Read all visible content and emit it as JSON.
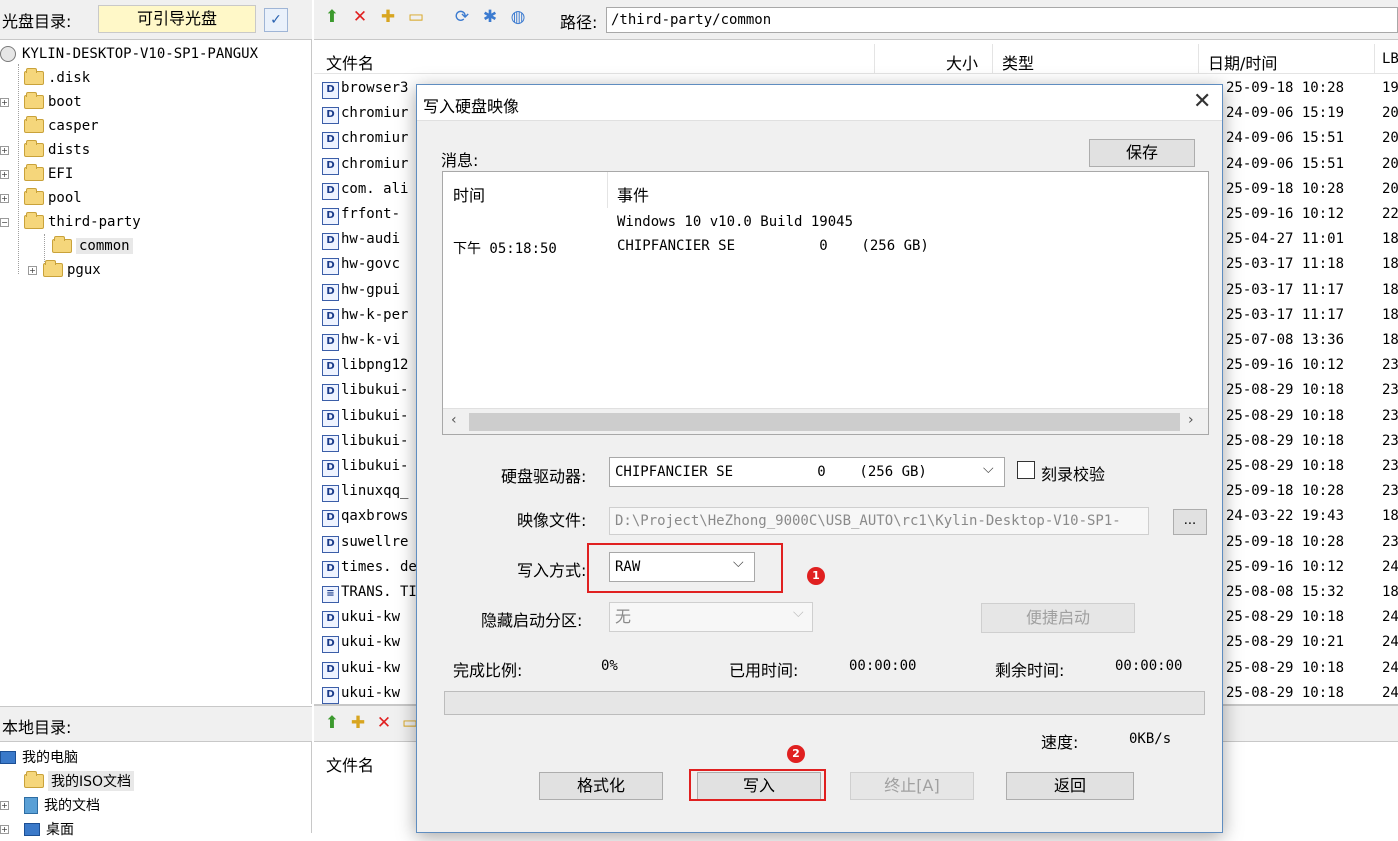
{
  "left_panel": {
    "disc_label": "光盘目录:",
    "disc_type": "可引导光盘",
    "tree": [
      {
        "label": "KYLIN-DESKTOP-V10-SP1-PANGUX"
      },
      {
        "label": ".disk"
      },
      {
        "label": "boot"
      },
      {
        "label": "casper"
      },
      {
        "label": "dists"
      },
      {
        "label": "EFI"
      },
      {
        "label": "pool"
      },
      {
        "label": "third-party"
      },
      {
        "label": "common"
      },
      {
        "label": "pgux"
      }
    ],
    "local_label": "本地目录:",
    "local_tree": [
      {
        "label": "我的电脑"
      },
      {
        "label": "我的ISO文档"
      },
      {
        "label": "我的文档"
      },
      {
        "label": "桌面"
      }
    ]
  },
  "right_panel": {
    "path_label": "路径:",
    "path_value": "/third-party/common",
    "columns": {
      "name": "文件名",
      "size": "大小",
      "type": "类型",
      "date": "日期/时间",
      "lba": "LB"
    },
    "files": [
      {
        "name": "browser3",
        "date": "25-09-18 10:28",
        "lba": "19"
      },
      {
        "name": "chromiur",
        "date": "24-09-06 15:19",
        "lba": "20"
      },
      {
        "name": "chromiur",
        "date": "24-09-06 15:51",
        "lba": "20"
      },
      {
        "name": "chromiur",
        "date": "24-09-06 15:51",
        "lba": "20"
      },
      {
        "name": "com. ali",
        "date": "25-09-18 10:28",
        "lba": "20"
      },
      {
        "name": "frfont-",
        "date": "25-09-16 10:12",
        "lba": "22"
      },
      {
        "name": "hw-audi",
        "date": "25-04-27 11:01",
        "lba": "18"
      },
      {
        "name": "hw-govc",
        "date": "25-03-17 11:18",
        "lba": "18"
      },
      {
        "name": "hw-gpui",
        "date": "25-03-17 11:17",
        "lba": "18"
      },
      {
        "name": "hw-k-per",
        "date": "25-03-17 11:17",
        "lba": "18"
      },
      {
        "name": "hw-k-vi",
        "date": "25-07-08 13:36",
        "lba": "18"
      },
      {
        "name": "libpng12",
        "date": "25-09-16 10:12",
        "lba": "23"
      },
      {
        "name": "libukui-",
        "date": "25-08-29 10:18",
        "lba": "23"
      },
      {
        "name": "libukui-",
        "date": "25-08-29 10:18",
        "lba": "23"
      },
      {
        "name": "libukui-",
        "date": "25-08-29 10:18",
        "lba": "23"
      },
      {
        "name": "libukui-",
        "date": "25-08-29 10:18",
        "lba": "23"
      },
      {
        "name": "linuxqq_",
        "date": "25-09-18 10:28",
        "lba": "23"
      },
      {
        "name": "qaxbrows",
        "date": "24-03-22 19:43",
        "lba": "18"
      },
      {
        "name": "suwellre",
        "date": "25-09-18 10:28",
        "lba": "23"
      },
      {
        "name": "times. de",
        "date": "25-09-16 10:12",
        "lba": "24"
      },
      {
        "name": "TRANS. TI",
        "date": "25-08-08 15:32",
        "lba": "18"
      },
      {
        "name": "ukui-kw",
        "date": "25-08-29 10:18",
        "lba": "24"
      },
      {
        "name": "ukui-kw",
        "date": "25-08-29 10:21",
        "lba": "24"
      },
      {
        "name": "ukui-kw",
        "date": "25-08-29 10:18",
        "lba": "24"
      },
      {
        "name": "ukui-kw",
        "date": "25-08-29 10:18",
        "lba": "24"
      }
    ],
    "local_col_name": "文件名"
  },
  "dialog": {
    "title": "写入硬盘映像",
    "messages_label": "消息:",
    "save_button": "保存",
    "log_col_time": "时间",
    "log_col_event": "事件",
    "log_line1": "Windows 10 v10.0 Build 19045",
    "log_time2": "下午 05:18:50",
    "log_line2": "CHIPFANCIER SE          0    (256 GB)",
    "drive_label": "硬盘驱动器:",
    "drive_value": "CHIPFANCIER SE          0    (256 GB)",
    "verify_label": "刻录校验",
    "image_label": "映像文件:",
    "image_value": "D:\\Project\\HeZhong_9000C\\USB_AUTO\\rc1\\Kylin-Desktop-V10-SP1-",
    "browse_button": "...",
    "method_label": "写入方式:",
    "method_value": "RAW",
    "hide_label": "隐藏启动分区:",
    "hide_value": "无",
    "quick_boot_button": "便捷启动",
    "complete_label": "完成比例:",
    "complete_value": "0%",
    "elapsed_label": "已用时间:",
    "elapsed_value": "00:00:00",
    "remaining_label": "剩余时间:",
    "remaining_value": "00:00:00",
    "progress": 0,
    "speed_label": "速度:",
    "speed_value": "0KB/s",
    "format_button": "格式化",
    "write_button": "写入",
    "stop_button": "终止[A]",
    "back_button": "返回",
    "marker1": "1",
    "marker2": "2"
  }
}
